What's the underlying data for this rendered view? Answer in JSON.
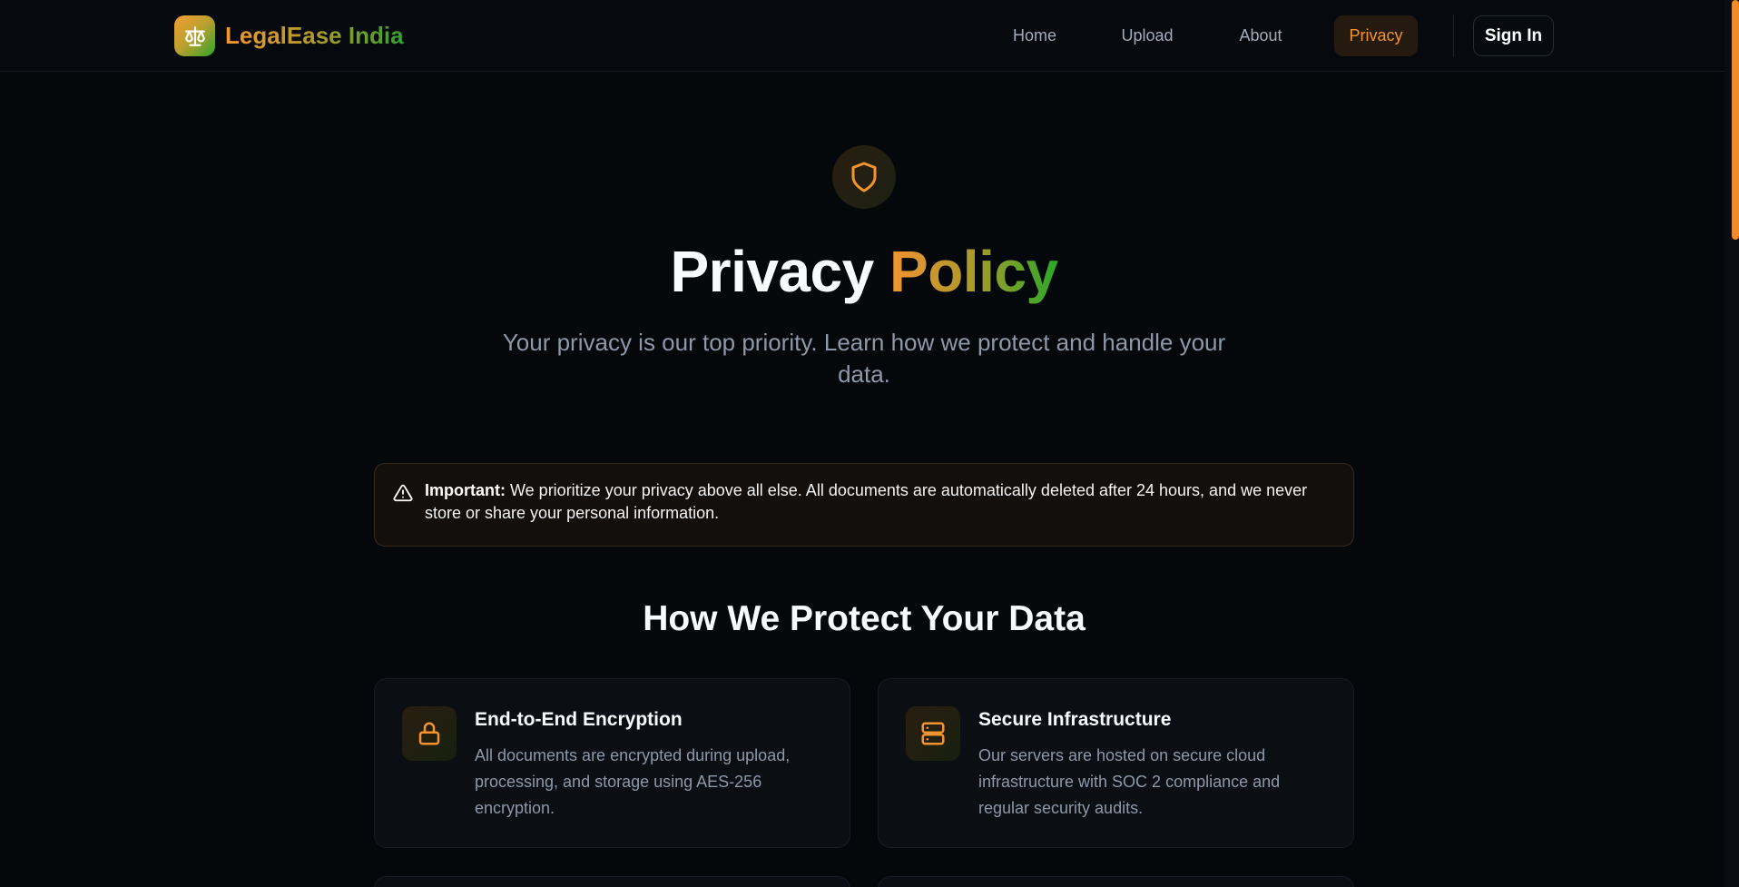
{
  "header": {
    "brand": "LegalEase India",
    "nav": [
      {
        "label": "Home"
      },
      {
        "label": "Upload"
      },
      {
        "label": "About"
      },
      {
        "label": "Privacy",
        "active": true
      }
    ],
    "sign_in": "Sign In"
  },
  "hero": {
    "title_plain": "Privacy",
    "title_accent": "Policy",
    "subtitle": "Your privacy is our top priority. Learn how we protect and handle your data."
  },
  "notice": {
    "label": "Important:",
    "text": " We prioritize your privacy above all else. All documents are automatically deleted after 24 hours, and we never store or share your personal information."
  },
  "section": {
    "title": "How We Protect Your Data",
    "cards": [
      {
        "icon": "lock-icon",
        "title": "End-to-End Encryption",
        "description": "All documents are encrypted during upload, processing, and storage using AES-256 encryption."
      },
      {
        "icon": "server-icon",
        "title": "Secure Infrastructure",
        "description": "Our servers are hosted on secure cloud infrastructure with SOC 2 compliance and regular security audits."
      }
    ]
  },
  "colors": {
    "accent_orange": "#f5932f",
    "accent_green": "#2aa82a",
    "background": "#05080b"
  }
}
